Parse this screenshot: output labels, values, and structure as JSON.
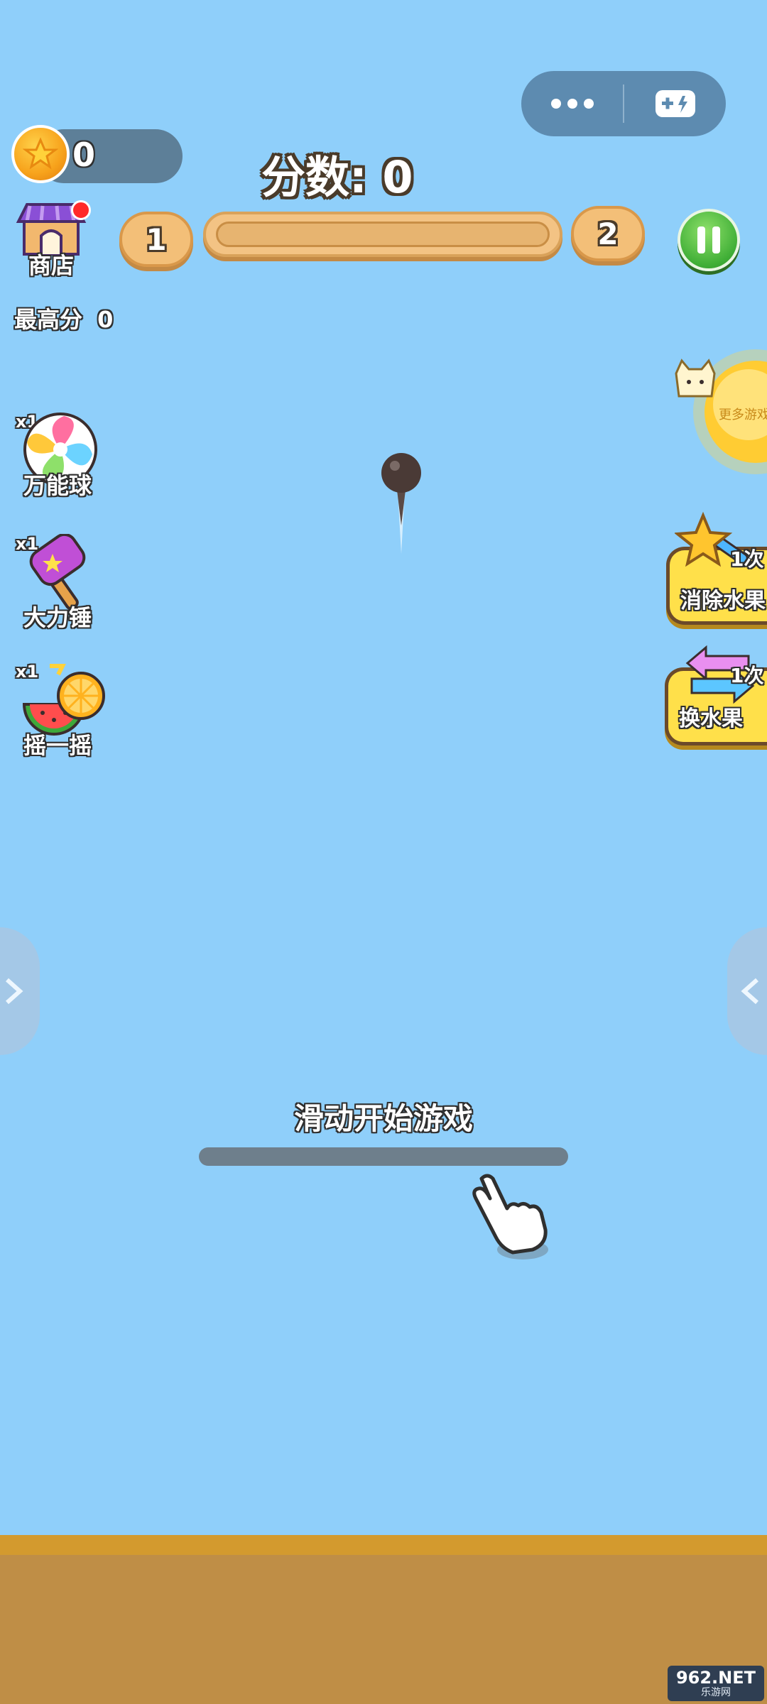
{
  "capsule": {
    "more_icon": "more-dots-icon",
    "game_icon": "gamepad-icon"
  },
  "coins": {
    "icon": "star-coin-icon",
    "value": "0"
  },
  "score": {
    "label": "分数: 0"
  },
  "shop": {
    "label": "商店",
    "badge_color": "#ff2a2a"
  },
  "level": {
    "current": "1",
    "next": "2",
    "progress": 0
  },
  "pause": {
    "icon": "pause-icon"
  },
  "best": {
    "label": "最高分",
    "value": "0"
  },
  "powerups": [
    {
      "count": "x1",
      "label": "万能球",
      "icon": "candy-ball-icon"
    },
    {
      "count": "x1",
      "label": "大力锤",
      "icon": "hammer-icon"
    },
    {
      "count": "x1",
      "label": "摇一摇",
      "icon": "fruit-icon"
    }
  ],
  "right_buttons": [
    {
      "count": "1次",
      "label": "消除水果",
      "icon": "star-wand-icon"
    },
    {
      "count": "1次",
      "label": "换水果",
      "icon": "swap-arrows-icon"
    }
  ],
  "more_games": {
    "label": "更多游戏",
    "icon": "sun-cat-icon"
  },
  "hint": {
    "text": "滑动开始游戏"
  },
  "watermark": {
    "main": "962.NET",
    "sub": "乐游网"
  },
  "colors": {
    "sky": "#8fcffa",
    "ground": "#bf8e46",
    "ground_top": "#d39a2e"
  }
}
